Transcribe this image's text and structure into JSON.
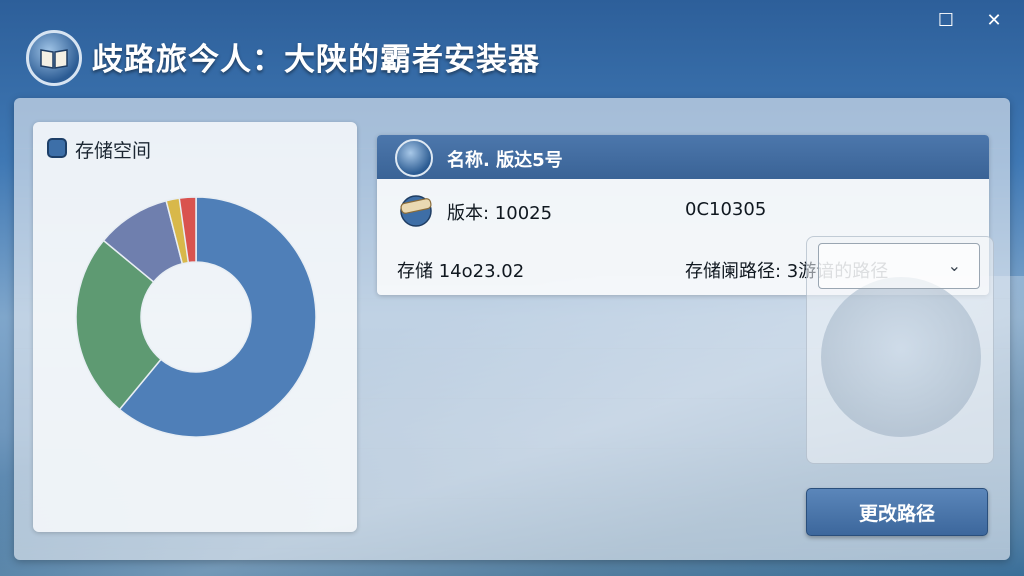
{
  "window": {
    "title": "歧路旅今人：大陕的霸者安装器",
    "maximize_glyph": "☐",
    "close_glyph": "✕"
  },
  "storage": {
    "title": "存储空间",
    "chart_data": {
      "type": "pie",
      "categories": [
        "",
        "",
        "",
        ""
      ],
      "values": [
        61,
        25,
        10,
        4
      ],
      "colors": [
        "#4f7fb8",
        "#5e9a72",
        "#6f7fae",
        "#d8b84a"
      ]
    },
    "extra_slice_color": "#d9534f"
  },
  "info": {
    "name_label": "名称. 版达5号",
    "version_label": "版本: 10025",
    "version_code": "0C10305",
    "storage_label": "存储 14o23.02",
    "install_path_label": "存储阑路径: 3游谙的路径"
  },
  "change_button": {
    "label": "更改路径"
  },
  "colors": {
    "accent": "#3a6396",
    "button": "#4c77ac"
  }
}
